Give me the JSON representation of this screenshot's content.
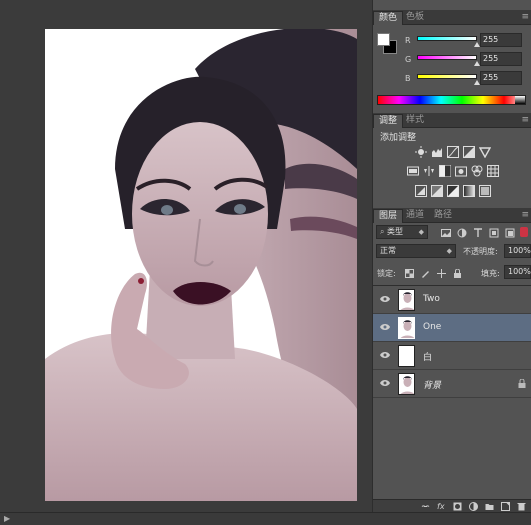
{
  "color_panel": {
    "tabs": [
      {
        "label": "颜色",
        "active": true
      },
      {
        "label": "色板",
        "active": false
      }
    ],
    "foreground": "#ffffff",
    "background": "#000000",
    "channels": [
      {
        "label": "R",
        "value": "255",
        "fraction": 1.0
      },
      {
        "label": "G",
        "value": "255",
        "fraction": 1.0
      },
      {
        "label": "B",
        "value": "255",
        "fraction": 1.0
      }
    ]
  },
  "adjustments_panel": {
    "tabs": [
      {
        "label": "调整",
        "active": true
      },
      {
        "label": "样式",
        "active": false
      }
    ],
    "title": "添加调整",
    "icons": [
      [
        "brightness-contrast-icon",
        "levels-icon",
        "curves-icon",
        "exposure-icon",
        "vibrance-icon"
      ],
      [
        "hue-saturation-icon",
        "color-balance-icon",
        "black-white-icon",
        "photo-filter-icon",
        "channel-mixer-icon",
        "color-lookup-icon"
      ],
      [
        "invert-icon",
        "posterize-icon",
        "threshold-icon",
        "gradient-map-icon",
        "selective-color-icon"
      ]
    ]
  },
  "layers_panel": {
    "tabs": [
      {
        "label": "图层",
        "active": true
      },
      {
        "label": "通道",
        "active": false
      },
      {
        "label": "路径",
        "active": false
      }
    ],
    "filter_kind": "类型",
    "blend_mode": "正常",
    "opacity_label": "不透明度:",
    "opacity_value": "100%",
    "lock_label": "锁定:",
    "fill_label": "填充:",
    "fill_value": "100%",
    "layers": [
      {
        "name": "Two",
        "visible": true,
        "selected": false,
        "locked": false,
        "italic": false
      },
      {
        "name": "One",
        "visible": true,
        "selected": true,
        "locked": false,
        "italic": false
      },
      {
        "name": "白",
        "visible": true,
        "selected": false,
        "locked": false,
        "italic": false
      },
      {
        "name": "背景",
        "visible": true,
        "selected": false,
        "locked": true,
        "italic": true
      }
    ]
  },
  "colors": {
    "panel_bg": "#535353",
    "selected_layer": "#5d6d83"
  }
}
